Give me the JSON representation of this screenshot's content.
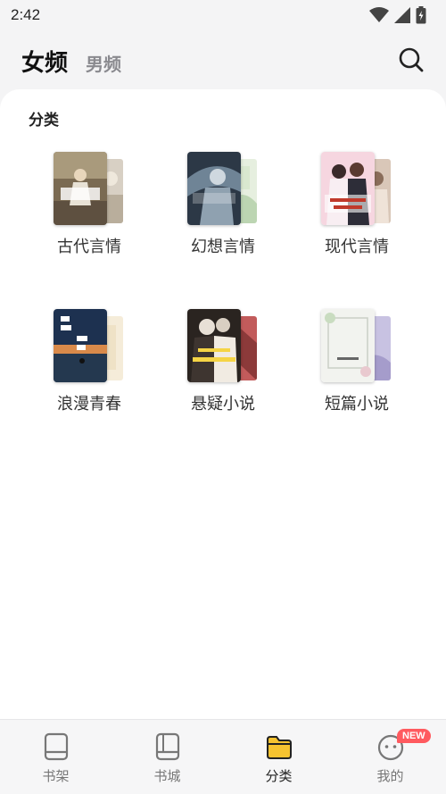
{
  "status_bar": {
    "time": "2:42"
  },
  "header": {
    "tab_active": "女频",
    "tab_inactive": "男频"
  },
  "section": {
    "title": "分类"
  },
  "categories": [
    {
      "label": "古代言情",
      "cover_text": "穿越村姑带着种田养家",
      "front_color": "#7a6a52",
      "back_color": "#d8d0c4"
    },
    {
      "label": "幻想言情",
      "cover_text": "我才是第一女仙帝",
      "front_color": "#3b4a5a",
      "back_color": "#cfe2c8"
    },
    {
      "label": "现代言情",
      "cover_text": "顾少宠妻花样多",
      "front_color": "#f3c9d6",
      "back_color": "#d9c7b8"
    },
    {
      "label": "浪漫青春",
      "cover_text": "坠落",
      "front_color": "#1f3550",
      "back_color": "#f1e6cf"
    },
    {
      "label": "悬疑小说",
      "cover_text": "主播她沉迷破案",
      "front_color": "#2a2420",
      "back_color": "#c25b5b"
    },
    {
      "label": "短篇小说",
      "cover_text": "绿茵青筱",
      "front_color": "#eef0ea",
      "back_color": "#b9b2d6"
    }
  ],
  "bottom_nav": {
    "items": [
      {
        "label": "书架"
      },
      {
        "label": "书城"
      },
      {
        "label": "分类"
      },
      {
        "label": "我的"
      }
    ],
    "badge": "NEW",
    "active_color": "#f6c330"
  }
}
